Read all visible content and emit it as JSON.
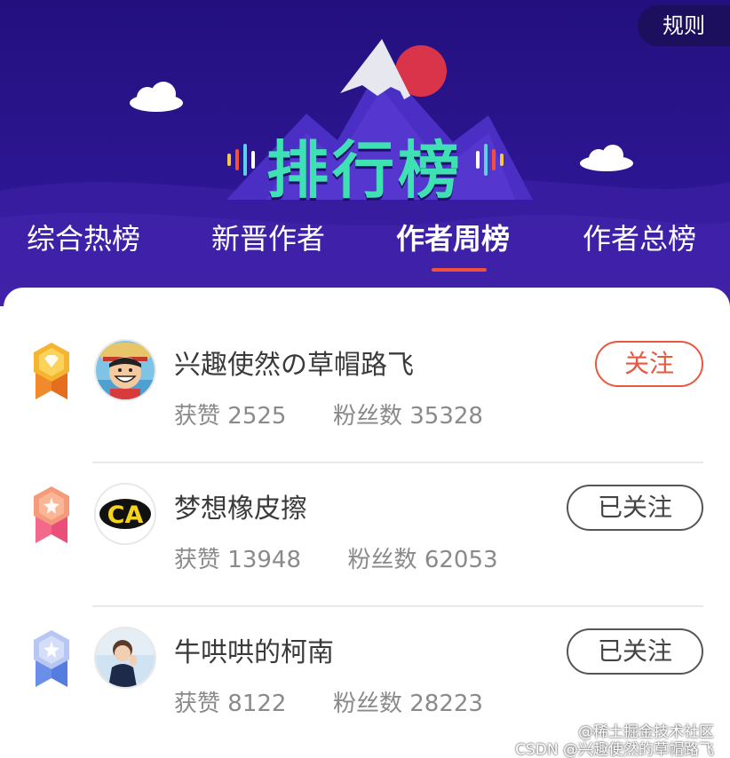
{
  "header": {
    "title": "排行榜",
    "rules_label": "规则"
  },
  "tabs": [
    {
      "label": "综合热榜",
      "active": false
    },
    {
      "label": "新晋作者",
      "active": false
    },
    {
      "label": "作者周榜",
      "active": true
    },
    {
      "label": "作者总榜",
      "active": false
    }
  ],
  "ranking": [
    {
      "rank": 1,
      "medal": "gold-diamond-medal-icon",
      "name": "兴趣使然の草帽路飞",
      "likes_label": "获赞",
      "likes": "2525",
      "fans_label": "粉丝数",
      "fans": "35328",
      "follow_label": "关注",
      "followed": false
    },
    {
      "rank": 2,
      "medal": "pink-star-medal-icon",
      "name": "梦想橡皮擦",
      "likes_label": "获赞",
      "likes": "13948",
      "fans_label": "粉丝数",
      "fans": "62053",
      "follow_label": "已关注",
      "followed": true
    },
    {
      "rank": 3,
      "medal": "blue-star-medal-icon",
      "name": "牛哄哄的柯南",
      "likes_label": "获赞",
      "likes": "8122",
      "fans_label": "粉丝数",
      "fans": "28223",
      "follow_label": "已关注",
      "followed": true
    }
  ],
  "avatar_badge_text": "CA",
  "watermark": {
    "line1": "@稀土掘金技术社区",
    "line2": "CSDN @兴趣使然的草帽路飞"
  },
  "colors": {
    "hero_bg": "#2c1590",
    "title_color": "#3fe0b4",
    "accent": "#f0503c",
    "follow_red": "#e8583f"
  }
}
